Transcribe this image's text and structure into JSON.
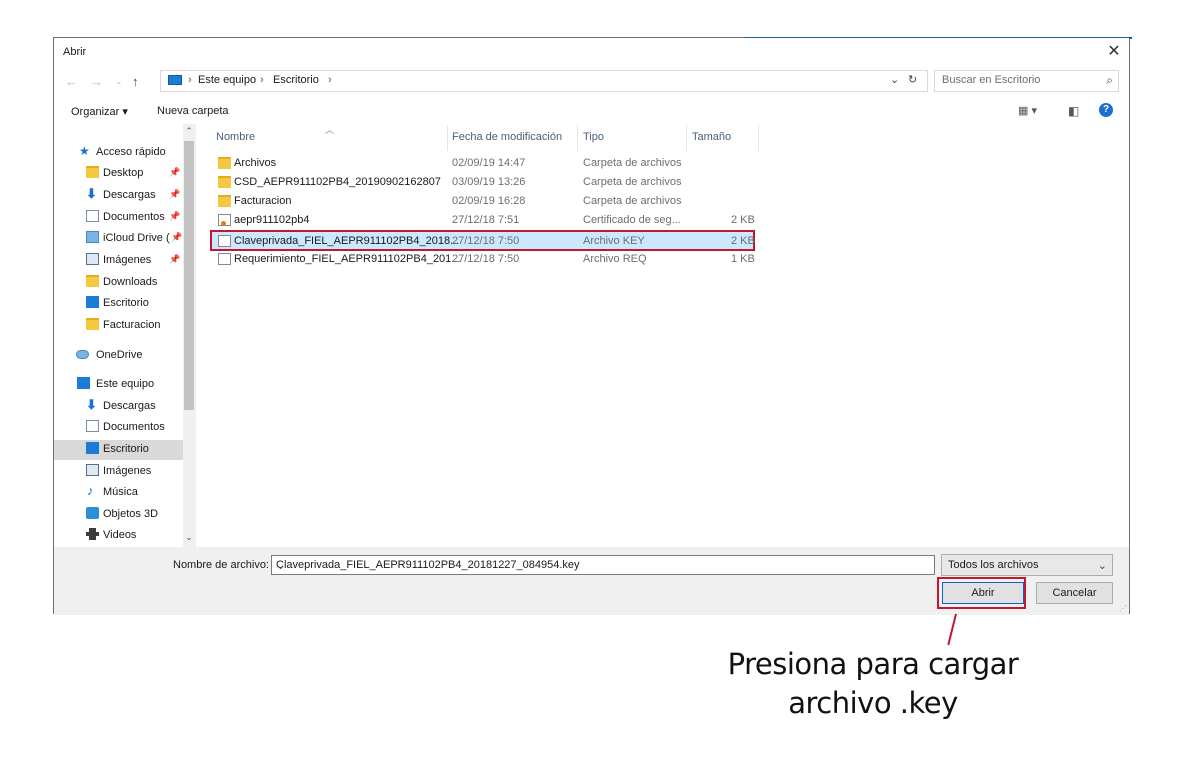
{
  "window": {
    "title": "Abrir",
    "close_symbol": "✕"
  },
  "address": {
    "breadcrumbs": [
      "Este equipo",
      "Escritorio"
    ],
    "search_placeholder": "Buscar en Escritorio"
  },
  "toolbar": {
    "organize_label": "Organizar ▾",
    "new_folder_label": "Nueva carpeta"
  },
  "nav": {
    "items": [
      {
        "label": "Acceso rápido",
        "icon": "star-icon",
        "pinned": false
      },
      {
        "label": "Desktop",
        "icon": "folder-icon",
        "pinned": true
      },
      {
        "label": "Descargas",
        "icon": "download-arrow-icon",
        "pinned": true
      },
      {
        "label": "Documentos",
        "icon": "document-icon",
        "pinned": true
      },
      {
        "label": "iCloud Drive (",
        "icon": "cloud-icon",
        "pinned": true
      },
      {
        "label": "Imágenes",
        "icon": "image-icon",
        "pinned": true
      },
      {
        "label": "Downloads",
        "icon": "folder-icon",
        "pinned": false
      },
      {
        "label": "Escritorio",
        "icon": "monitor-icon",
        "pinned": false
      },
      {
        "label": "Facturacion",
        "icon": "folder-icon",
        "pinned": false
      },
      {
        "label": "OneDrive",
        "icon": "cloud-icon",
        "pinned": false
      },
      {
        "label": "Este equipo",
        "icon": "computer-icon",
        "pinned": false
      },
      {
        "label": "Descargas",
        "icon": "download-arrow-icon",
        "pinned": false
      },
      {
        "label": "Documentos",
        "icon": "document-icon",
        "pinned": false
      },
      {
        "label": "Escritorio",
        "icon": "monitor-icon",
        "pinned": false,
        "selected": true
      },
      {
        "label": "Imágenes",
        "icon": "image-icon",
        "pinned": false
      },
      {
        "label": "Música",
        "icon": "music-note-icon",
        "pinned": false
      },
      {
        "label": "Objetos 3D",
        "icon": "cube-icon",
        "pinned": false
      },
      {
        "label": "Videos",
        "icon": "film-icon",
        "pinned": false
      }
    ]
  },
  "files": {
    "columns": {
      "name": "Nombre",
      "modified": "Fecha de modificación",
      "type": "Tipo",
      "size": "Tamaño"
    },
    "rows": [
      {
        "name": "Archivos",
        "modified": "02/09/19 14:47",
        "type": "Carpeta de archivos",
        "size": "",
        "icon": "folder-icon"
      },
      {
        "name": "CSD_AEPR911102PB4_20190902162807",
        "modified": "03/09/19 13:26",
        "type": "Carpeta de archivos",
        "size": "",
        "icon": "folder-icon"
      },
      {
        "name": "Facturacion",
        "modified": "02/09/19 16:28",
        "type": "Carpeta de archivos",
        "size": "",
        "icon": "folder-icon"
      },
      {
        "name": "aepr911102pb4",
        "modified": "27/12/18 7:51",
        "type": "Certificado de seg...",
        "size": "2 KB",
        "icon": "certificate-icon"
      },
      {
        "name": "Claveprivada_FIEL_AEPR911102PB4_2018...",
        "modified": "27/12/18 7:50",
        "type": "Archivo KEY",
        "size": "2 KB",
        "icon": "file-icon",
        "selected": true
      },
      {
        "name": "Requerimiento_FIEL_AEPR911102PB4_201...",
        "modified": "27/12/18 7:50",
        "type": "Archivo REQ",
        "size": "1 KB",
        "icon": "file-icon"
      }
    ]
  },
  "bottom": {
    "filename_label": "Nombre de archivo:",
    "filename_value": "Claveprivada_FIEL_AEPR911102PB4_20181227_084954.key",
    "filter_value": "Todos los archivos",
    "open_label": "Abrir",
    "cancel_label": "Cancelar"
  },
  "annotation": {
    "line1": "Presiona para cargar",
    "line2": "archivo .key"
  },
  "colors": {
    "highlight_red": "#c0182e",
    "selection_blue": "#cce8ff",
    "accent_blue": "#1a6fd1"
  }
}
